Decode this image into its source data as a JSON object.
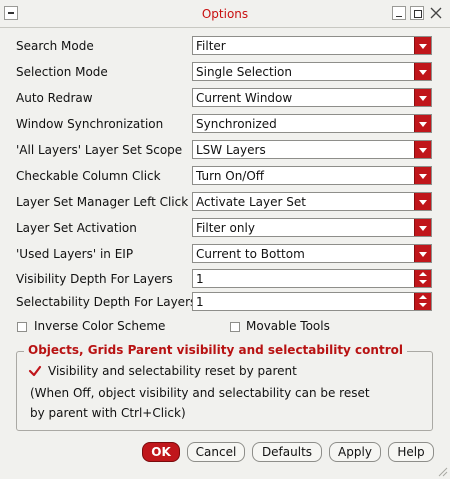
{
  "window": {
    "title": "Options"
  },
  "settings": [
    {
      "label": "Search Mode",
      "value": "Filter"
    },
    {
      "label": "Selection Mode",
      "value": "Single Selection"
    },
    {
      "label": "Auto Redraw",
      "value": "Current Window"
    },
    {
      "label": "Window Synchronization",
      "value": "Synchronized"
    },
    {
      "label": "'All Layers' Layer Set Scope",
      "value": "LSW Layers"
    },
    {
      "label": "Checkable Column Click",
      "value": "Turn On/Off"
    },
    {
      "label": "Layer Set Manager Left Click",
      "value": "Activate Layer Set"
    },
    {
      "label": "Layer Set Activation",
      "value": "Filter only"
    },
    {
      "label": "'Used Layers' in EIP",
      "value": "Current to Bottom"
    }
  ],
  "spinners": [
    {
      "label": "Visibility Depth For Layers",
      "value": "1"
    },
    {
      "label": "Selectability Depth For Layers",
      "value": "1"
    }
  ],
  "checkboxes": {
    "inverse_color": {
      "label": "Inverse Color Scheme",
      "checked": false
    },
    "movable_tools": {
      "label": "Movable Tools",
      "checked": false
    }
  },
  "group": {
    "title": "Objects, Grids Parent visibility and selectability control",
    "checkbox_label": "Visibility and selectability reset by parent",
    "checked": true,
    "note_line1": "(When Off, object visibility and selectability can be reset",
    "note_line2": "by parent with Ctrl+Click)"
  },
  "buttons": {
    "ok": "OK",
    "cancel": "Cancel",
    "defaults": "Defaults",
    "apply": "Apply",
    "help": "Help"
  },
  "colors": {
    "accent": "#c0161b",
    "title": "#c81010",
    "background": "#f1f1ee"
  }
}
